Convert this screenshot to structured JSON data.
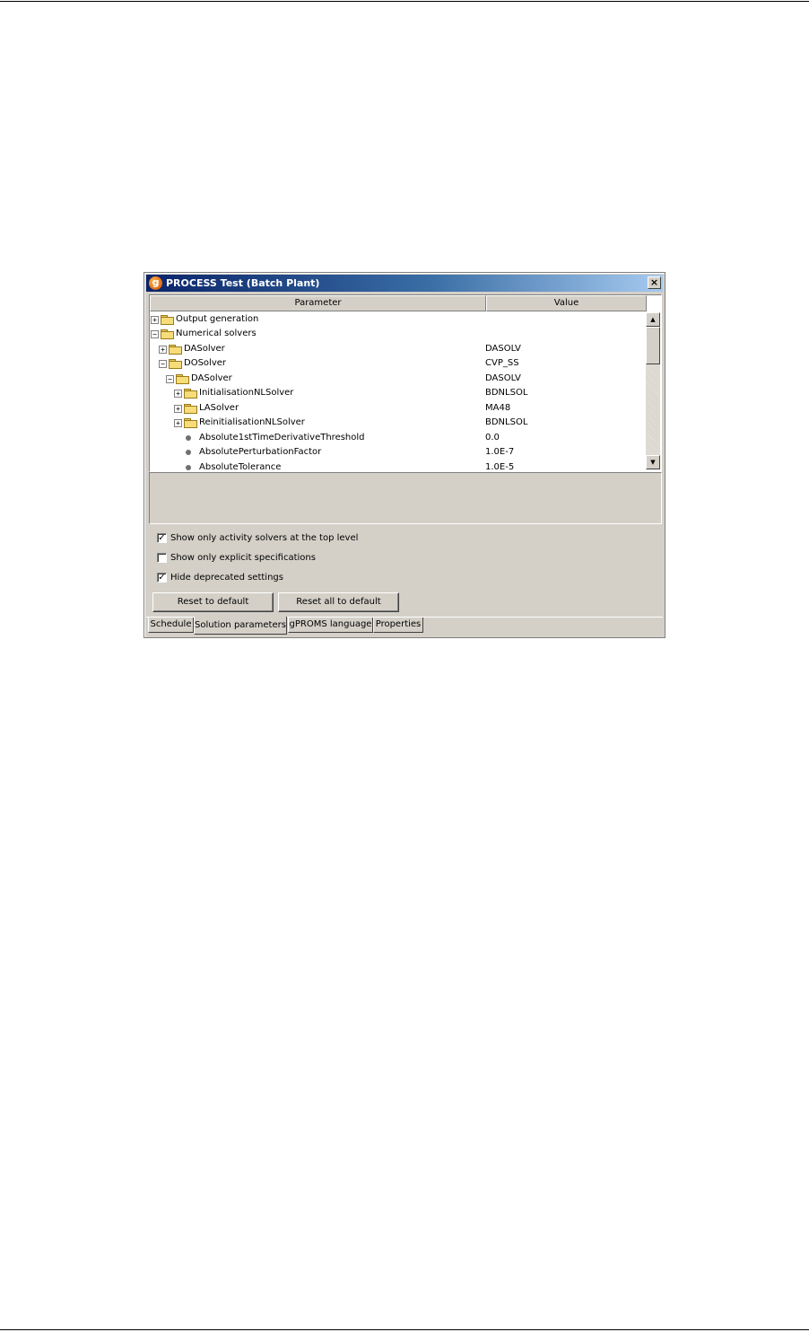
{
  "window": {
    "title": "PROCESS Test (Batch Plant)",
    "app_icon_glyph": "g",
    "close_glyph": "×"
  },
  "table": {
    "headers": {
      "parameter": "Parameter",
      "value": "Value"
    },
    "rows": [
      {
        "label": "Output generation",
        "value": "",
        "kind": "folder",
        "toggle": "+",
        "depth": 0
      },
      {
        "label": "Numerical solvers",
        "value": "",
        "kind": "folder",
        "toggle": "−",
        "depth": 0
      },
      {
        "label": "DASolver",
        "value": "DASOLV",
        "kind": "folder",
        "toggle": "+",
        "depth": 1
      },
      {
        "label": "DOSolver",
        "value": "CVP_SS",
        "kind": "folder",
        "toggle": "−",
        "depth": 1
      },
      {
        "label": "DASolver",
        "value": "DASOLV",
        "kind": "folder",
        "toggle": "−",
        "depth": 2
      },
      {
        "label": "InitialisationNLSolver",
        "value": "BDNLSOL",
        "kind": "folder",
        "toggle": "+",
        "depth": 3
      },
      {
        "label": "LASolver",
        "value": "MA48",
        "kind": "folder",
        "toggle": "+",
        "depth": 3
      },
      {
        "label": "ReinitialisationNLSolver",
        "value": "BDNLSOL",
        "kind": "folder",
        "toggle": "+",
        "depth": 3
      },
      {
        "label": "Absolute1stTimeDerivativeThreshold",
        "value": "0.0",
        "kind": "leaf",
        "toggle": "",
        "depth": 3
      },
      {
        "label": "AbsolutePerturbationFactor",
        "value": "1.0E-7",
        "kind": "leaf",
        "toggle": "",
        "depth": 3
      },
      {
        "label": "AbsoluteTolerance",
        "value": "1.0E-5",
        "kind": "leaf",
        "toggle": "",
        "depth": 3
      }
    ]
  },
  "scrollbar": {
    "up_glyph": "▲",
    "down_glyph": "▼"
  },
  "options": [
    {
      "label": "Show only activity solvers at the top level",
      "checked": true
    },
    {
      "label": "Show only explicit specifications",
      "checked": false
    },
    {
      "label": "Hide deprecated settings",
      "checked": true
    }
  ],
  "check_glyph": "✓",
  "buttons": {
    "reset": "Reset to default",
    "reset_all": "Reset all to default"
  },
  "tabs": [
    {
      "label": "Schedule",
      "active": false
    },
    {
      "label": "Solution parameters",
      "active": true
    },
    {
      "label": "gPROMS language",
      "active": false
    },
    {
      "label": "Properties",
      "active": false
    }
  ]
}
